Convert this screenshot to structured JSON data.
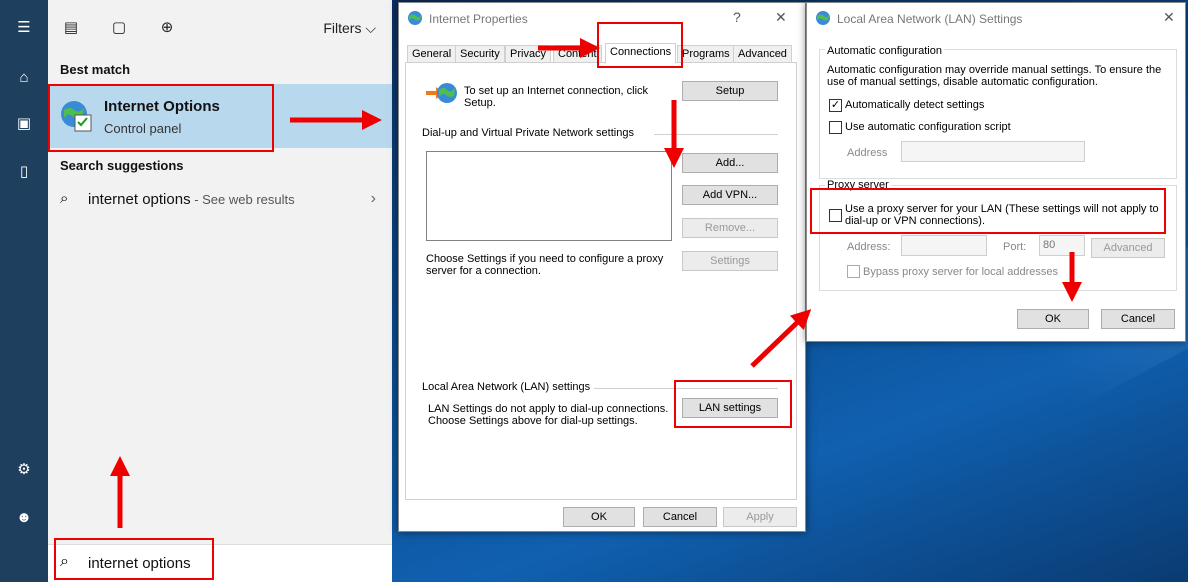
{
  "start_menu": {
    "filters_label": "Filters",
    "best_match_heading": "Best match",
    "best_match": {
      "title": "Internet Options",
      "subtitle": "Control panel"
    },
    "suggestions_heading": "Search suggestions",
    "suggestion": {
      "query": "internet options",
      "suffix": " - See web results"
    },
    "search_value": "internet options"
  },
  "internet_properties": {
    "title": "Internet Properties",
    "help": "?",
    "close": "✕",
    "tabs": [
      "General",
      "Security",
      "Privacy",
      "Content",
      "Connections",
      "Programs",
      "Advanced"
    ],
    "setup_text": "To set up an Internet connection, click Setup.",
    "setup_button": "Setup",
    "vpn_heading": "Dial-up and Virtual Private Network settings",
    "add_button": "Add...",
    "add_vpn_button": "Add VPN...",
    "remove_button": "Remove...",
    "settings_text": "Choose Settings if you need to configure a proxy server for a connection.",
    "settings_button": "Settings",
    "lan_heading": "Local Area Network (LAN) settings",
    "lan_text": "LAN Settings do not apply to dial-up connections. Choose Settings above for dial-up settings.",
    "lan_button": "LAN settings",
    "ok": "OK",
    "cancel": "Cancel",
    "apply": "Apply"
  },
  "lan_dialog": {
    "title": "Local Area Network (LAN) Settings",
    "close": "✕",
    "auto_heading": "Automatic configuration",
    "auto_text": "Automatic configuration may override manual settings.  To ensure the use of manual settings, disable automatic configuration.",
    "auto_detect": "Automatically detect settings",
    "auto_script": "Use automatic configuration script",
    "address_label": "Address",
    "proxy_heading": "Proxy server",
    "use_proxy": "Use a proxy server for your LAN (These settings will not apply to dial-up or VPN connections).",
    "proxy_address_label": "Address:",
    "port_label": "Port:",
    "port_value": "80",
    "advanced_button": "Advanced",
    "bypass": "Bypass proxy server for local addresses",
    "ok": "OK",
    "cancel": "Cancel"
  },
  "colors": {
    "highlight": "#e00000",
    "selection": "#b8d8ee",
    "rail": "#1f3f5f"
  }
}
